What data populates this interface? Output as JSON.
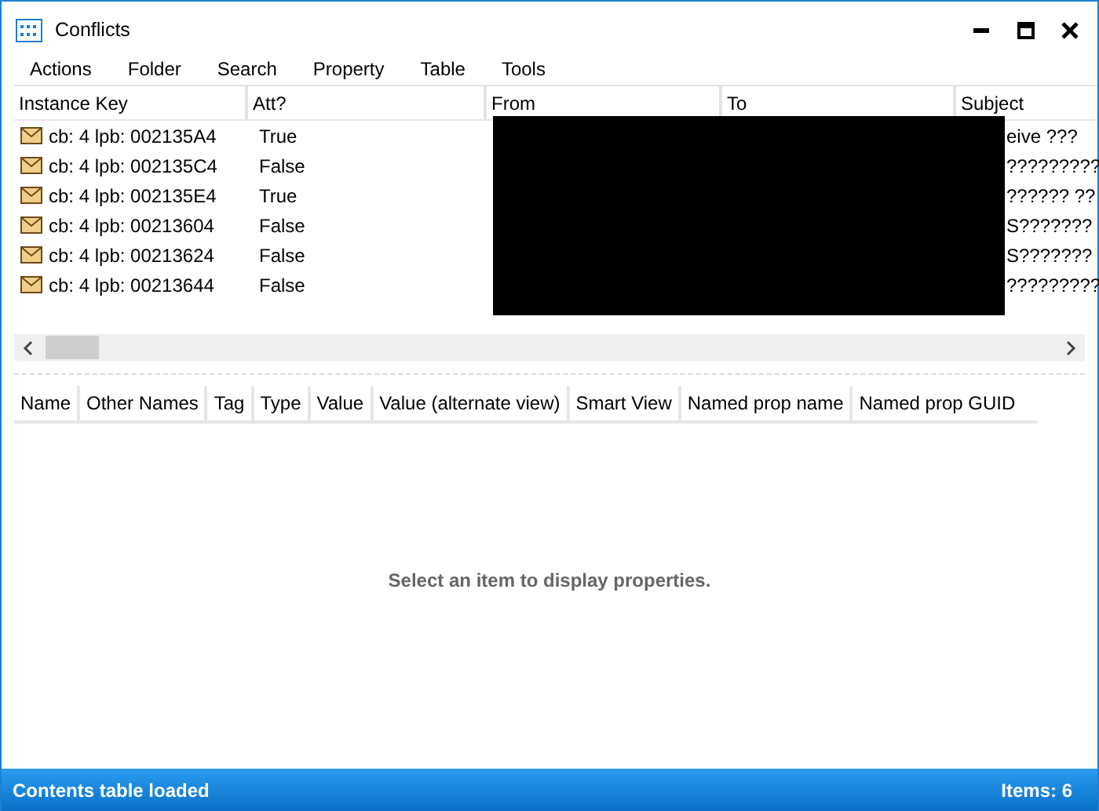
{
  "window": {
    "title": "Conflicts"
  },
  "menu": [
    "Actions",
    "Folder",
    "Search",
    "Property",
    "Table",
    "Tools"
  ],
  "table": {
    "columns": [
      "Instance Key",
      "Att?",
      "From",
      "To",
      "Subject"
    ],
    "rows": [
      {
        "instance_key": "cb: 4 lpb: 002135A4",
        "att": "True",
        "subject": "eive ???"
      },
      {
        "instance_key": "cb: 4 lpb: 002135C4",
        "att": "False",
        "subject": "?????????"
      },
      {
        "instance_key": "cb: 4 lpb: 002135E4",
        "att": "True",
        "subject": "?????? ??"
      },
      {
        "instance_key": "cb: 4 lpb: 00213604",
        "att": "False",
        "subject": "S???????"
      },
      {
        "instance_key": "cb: 4 lpb: 00213624",
        "att": "False",
        "subject": "S???????"
      },
      {
        "instance_key": "cb: 4 lpb: 00213644",
        "att": "False",
        "subject": "?????????"
      }
    ]
  },
  "properties": {
    "columns": [
      "Name",
      "Other Names",
      "Tag",
      "Type",
      "Value",
      "Value (alternate view)",
      "Smart View",
      "Named prop name",
      "Named prop GUID"
    ],
    "empty_message": "Select an item to display properties."
  },
  "status_bar": {
    "left": "Contents table loaded",
    "right": "Items: 6"
  }
}
